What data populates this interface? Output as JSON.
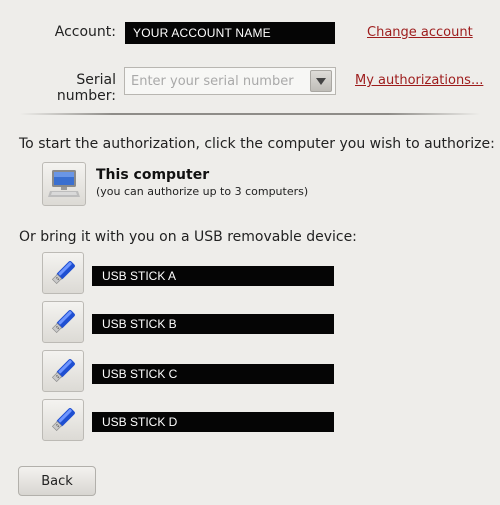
{
  "account": {
    "label": "Account:",
    "value": "YOUR ACCOUNT NAME",
    "change_link": "Change account"
  },
  "serial": {
    "label": "Serial number:",
    "placeholder": "Enter your serial number",
    "value": "",
    "authorizations_link": "My authorizations..."
  },
  "instructions": "To start the authorization, click the computer you wish to authorize:",
  "this_computer": {
    "title": "This computer",
    "subtitle": "(you can authorize up to 3 computers)",
    "icon": "computer-icon"
  },
  "usb_section": {
    "heading": "Or bring it with you on a USB removable device:",
    "devices": [
      {
        "name": "USB STICK A",
        "icon": "usb-stick-icon"
      },
      {
        "name": "USB STICK B",
        "icon": "usb-stick-icon"
      },
      {
        "name": "USB STICK C",
        "icon": "usb-stick-icon"
      },
      {
        "name": "USB STICK D",
        "icon": "usb-stick-icon"
      }
    ]
  },
  "back_label": "Back",
  "colors": {
    "background": "#eeedea",
    "link": "#9d1c1c",
    "name_box": "#050505",
    "usb_blue": "#1f4fd1"
  }
}
